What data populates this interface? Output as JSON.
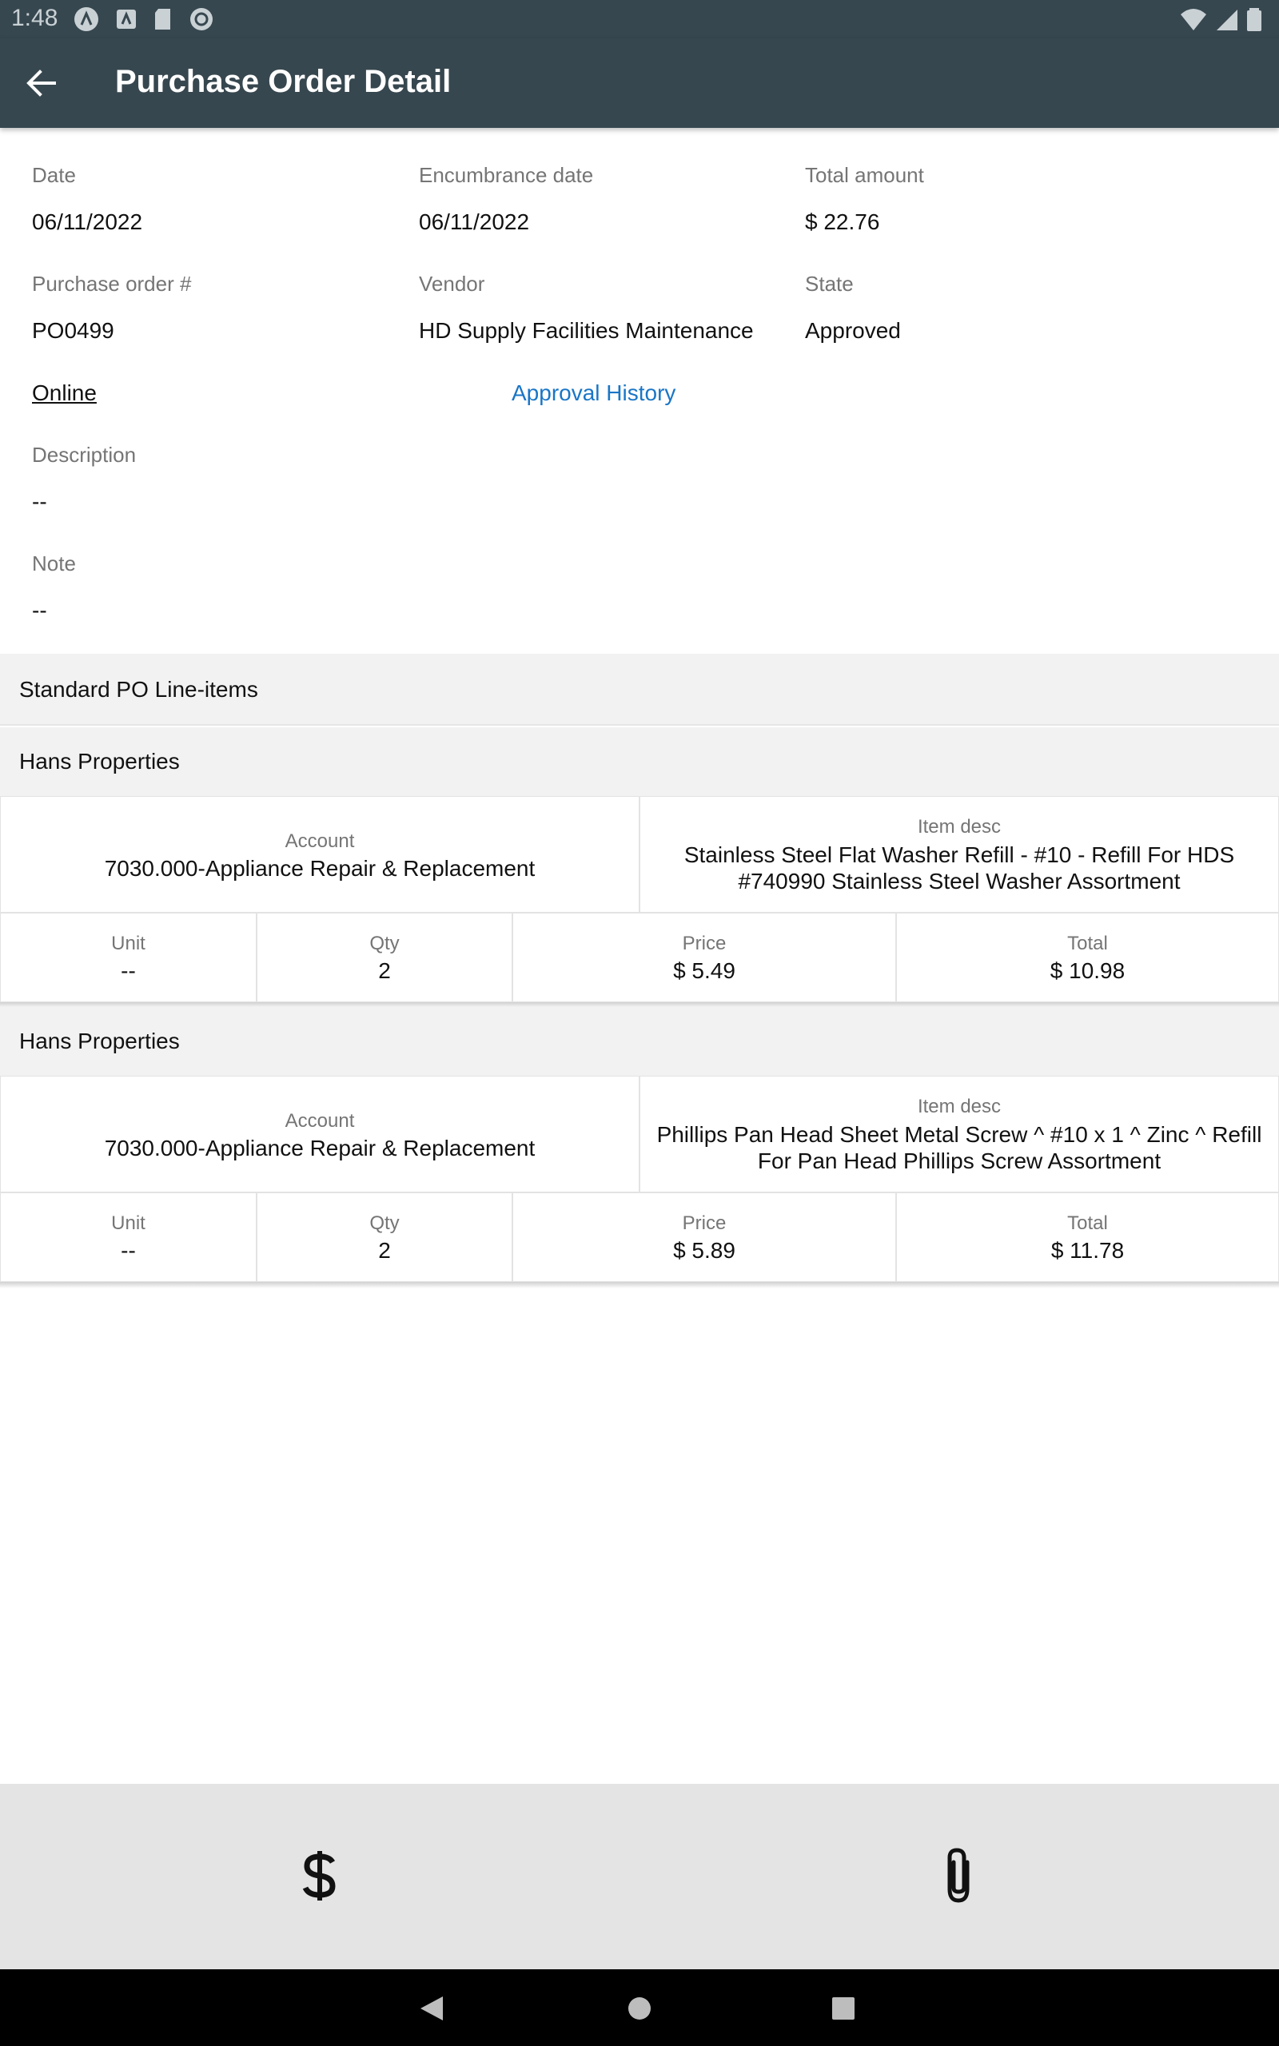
{
  "status_bar": {
    "time": "1:48"
  },
  "app_bar": {
    "title": "Purchase Order Detail",
    "back_icon": "arrow-left-icon"
  },
  "details": {
    "date": {
      "label": "Date",
      "value": "06/11/2022"
    },
    "encumbrance_date": {
      "label": "Encumbrance date",
      "value": "06/11/2022"
    },
    "total_amount": {
      "label": "Total amount",
      "value": "$ 22.76"
    },
    "po_number": {
      "label": "Purchase order #",
      "value": "PO0499"
    },
    "vendor": {
      "label": "Vendor",
      "value": "HD Supply Facilities Maintenance"
    },
    "state": {
      "label": "State",
      "value": "Approved"
    },
    "online_link": "Online",
    "approval_history_link": "Approval History",
    "description": {
      "label": "Description",
      "value": "--"
    },
    "note": {
      "label": "Note",
      "value": "--"
    }
  },
  "line_items_section": {
    "title": "Standard PO Line-items"
  },
  "line_items": [
    {
      "property": "Hans Properties",
      "account_label": "Account",
      "account": "7030.000-Appliance Repair & Replacement",
      "item_desc_label": "Item desc",
      "item_desc": "Stainless Steel Flat Washer Refill - #10 - Refill For HDS #740990 Stainless Steel Washer Assortment",
      "unit_label": "Unit",
      "unit": "--",
      "qty_label": "Qty",
      "qty": "2",
      "price_label": "Price",
      "price": "$ 5.49",
      "total_label": "Total",
      "total": "$ 10.98"
    },
    {
      "property": "Hans Properties",
      "account_label": "Account",
      "account": "7030.000-Appliance Repair & Replacement",
      "item_desc_label": "Item desc",
      "item_desc": "Phillips Pan Head Sheet Metal Screw ^ #10 x 1 ^ Zinc ^ Refill For Pan Head Phillips Screw Assortment",
      "unit_label": "Unit",
      "unit": "--",
      "qty_label": "Qty",
      "qty": "2",
      "price_label": "Price",
      "price": "$ 5.89",
      "total_label": "Total",
      "total": "$ 11.78"
    }
  ],
  "bottom_bar": {
    "left_icon": "dollar-icon",
    "right_icon": "paperclip-icon"
  },
  "colors": {
    "app_bar": "#37474f",
    "link": "#1a76c6",
    "section_bg": "#f2f2f2",
    "bottom_bar": "#e4e4e4"
  }
}
